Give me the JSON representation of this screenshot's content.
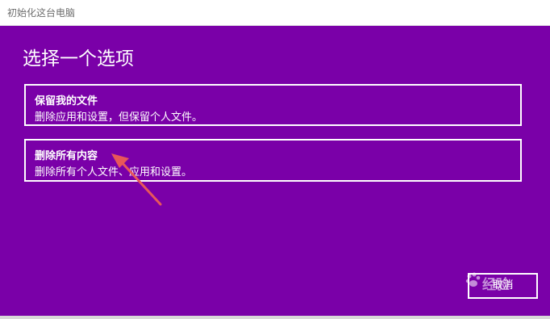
{
  "window": {
    "title": "初始化这台电脑"
  },
  "heading": "选择一个选项",
  "options": [
    {
      "title": "保留我的文件",
      "description": "删除应用和设置，但保留个人文件。"
    },
    {
      "title": "删除所有内容",
      "description": "删除所有个人文件、应用和设置。"
    }
  ],
  "cancel_label": "取消",
  "watermark": {
    "text": "经验",
    "icon": "baidu-paw-icon"
  },
  "colors": {
    "background": "#7a00a8",
    "arrow": "#e8575a",
    "foreground": "#ffffff"
  }
}
